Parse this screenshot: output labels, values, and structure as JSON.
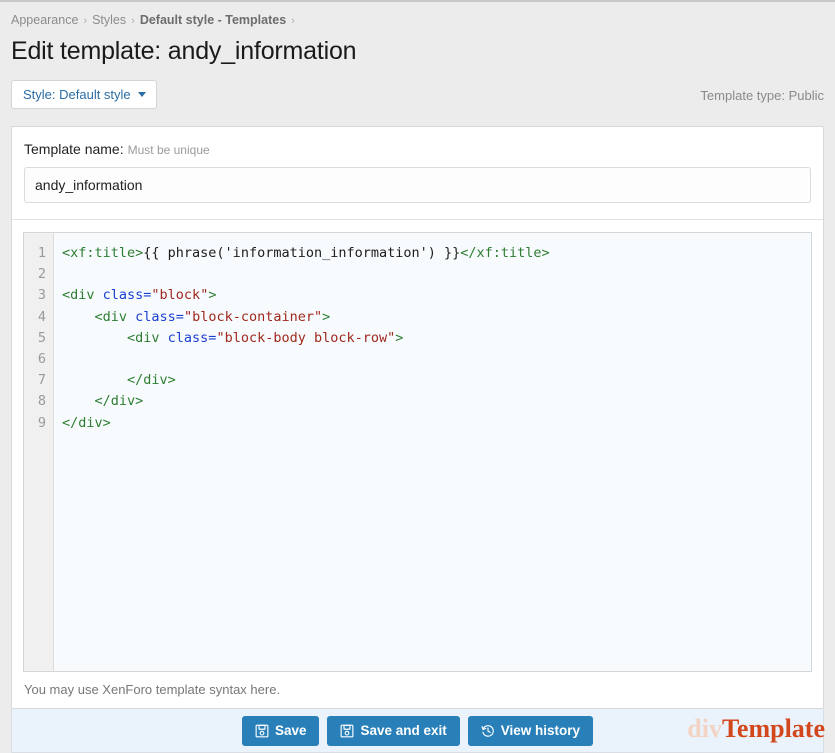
{
  "breadcrumb": {
    "separator": "›",
    "items": [
      {
        "label": "Appearance",
        "current": false
      },
      {
        "label": "Styles",
        "current": false
      },
      {
        "label": "Default style - Templates",
        "current": true
      }
    ]
  },
  "header": {
    "title": "Edit template: andy_information",
    "style_button_label": "Style: Default style",
    "template_type_label": "Template type: Public"
  },
  "form": {
    "name_label": "Template name:",
    "name_hint": "Must be unique",
    "name_value": "andy_information",
    "name_placeholder": "Template name"
  },
  "editor": {
    "line_numbers": [
      "1",
      "2",
      "3",
      "4",
      "5",
      "6",
      "7",
      "8",
      "9"
    ],
    "lines": [
      [
        {
          "t": "<xf:title>",
          "c": "tag"
        },
        {
          "t": "{{ phrase('information_information') }}",
          "c": "plain"
        },
        {
          "t": "</xf:title>",
          "c": "tag"
        }
      ],
      [],
      [
        {
          "t": "<div ",
          "c": "tag"
        },
        {
          "t": "class=",
          "c": "attr"
        },
        {
          "t": "\"block\"",
          "c": "str"
        },
        {
          "t": ">",
          "c": "tag"
        }
      ],
      [
        {
          "t": "    <div ",
          "c": "tag"
        },
        {
          "t": "class=",
          "c": "attr"
        },
        {
          "t": "\"block-container\"",
          "c": "str"
        },
        {
          "t": ">",
          "c": "tag"
        }
      ],
      [
        {
          "t": "        <div ",
          "c": "tag"
        },
        {
          "t": "class=",
          "c": "attr"
        },
        {
          "t": "\"block-body block-row\"",
          "c": "str"
        },
        {
          "t": ">",
          "c": "tag"
        }
      ],
      [],
      [
        {
          "t": "        </div>",
          "c": "tag"
        }
      ],
      [
        {
          "t": "    </div>",
          "c": "tag"
        }
      ],
      [
        {
          "t": "</div>",
          "c": "tag"
        }
      ]
    ],
    "help_text": "You may use XenForo template syntax here."
  },
  "footer": {
    "buttons": [
      {
        "label": "Save",
        "icon": "save-floppy-icon"
      },
      {
        "label": "Save and exit",
        "icon": "save-floppy-icon"
      },
      {
        "label": "View history",
        "icon": "history-clock-icon"
      }
    ]
  },
  "watermark": {
    "part1": "div",
    "part2": "Template"
  },
  "colors": {
    "accent_button": "#2980b9",
    "link": "#2b6ca3",
    "page_background": "#ececec",
    "editor_background": "#f7fbfd",
    "footer_background": "#eaf3fb",
    "syntax_tag": "#2e7d32",
    "syntax_attr": "#1a3fd1",
    "syntax_string": "#a0281e",
    "watermark_div": "#f3d3c3",
    "watermark_template": "#d2471c"
  }
}
